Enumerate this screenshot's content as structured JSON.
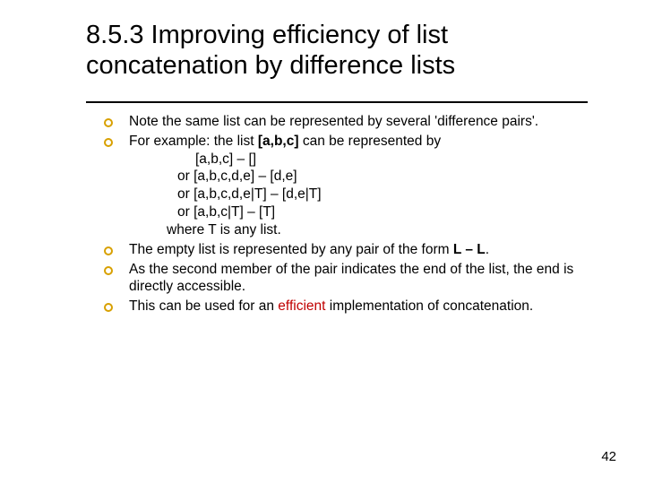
{
  "title": "8.5.3 Improving efficiency of list concatenation by difference lists",
  "bullets": [
    {
      "text": "Note the same list can be represented by several 'difference pairs'."
    },
    {
      "text_lead": "For example: the list ",
      "bold1": "[a,b,c]",
      "text_mid": " can be represented by",
      "line1": "[a,b,c] – []",
      "line2_pre": "or  ",
      "line2": "[a,b,c,d,e] – [d,e]",
      "line3_pre": "or  ",
      "line3": "[a,b,c,d,e|T] – [d,e|T]",
      "line4_pre": "or  ",
      "line4": "[a,b,c|T] – [T]",
      "where": "where T is any list."
    },
    {
      "text_lead": "The empty list is represented by any pair of the form ",
      "bold1": "L – L",
      "text_tail": "."
    },
    {
      "text": "As the second member of the pair indicates the end of the list, the end is directly accessible."
    },
    {
      "text_lead": "This can be used for an ",
      "efficient": "efficient",
      "text_tail": " implementation of concatenation."
    }
  ],
  "page_number": "42"
}
